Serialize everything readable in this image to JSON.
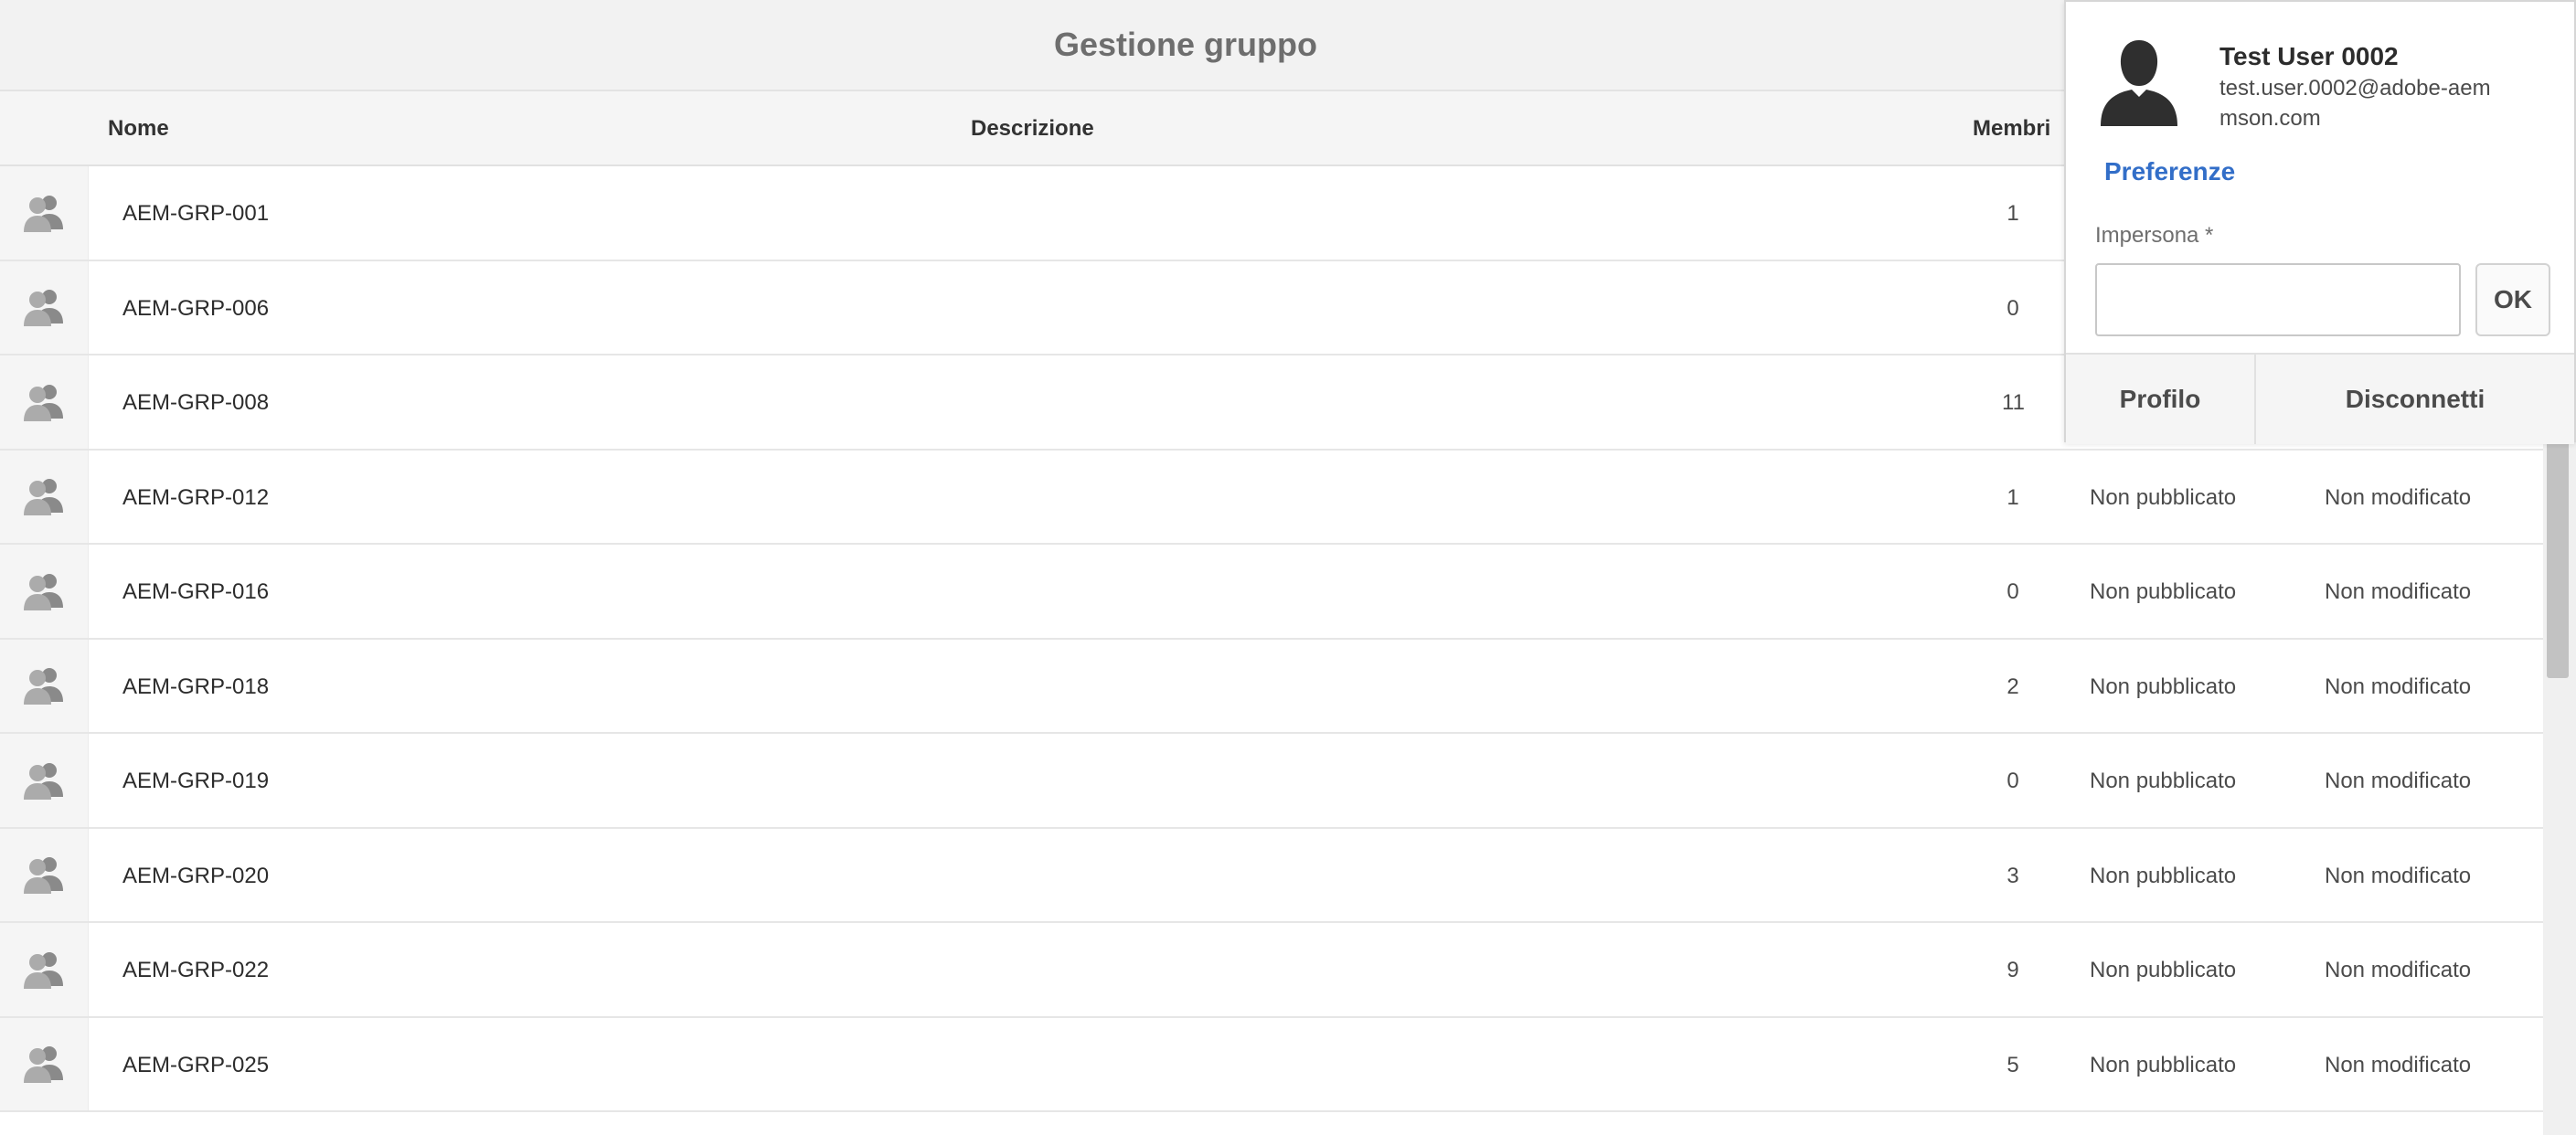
{
  "header": {
    "title": "Gestione gruppo"
  },
  "table": {
    "columns": {
      "name": "Nome",
      "description": "Descrizione",
      "members": "Membri"
    },
    "rows": [
      {
        "name": "AEM-GRP-001",
        "members": "1",
        "publication": "",
        "modification": ""
      },
      {
        "name": "AEM-GRP-006",
        "members": "0",
        "publication": "",
        "modification": ""
      },
      {
        "name": "AEM-GRP-008",
        "members": "11",
        "publication": "",
        "modification": ""
      },
      {
        "name": "AEM-GRP-012",
        "members": "1",
        "publication": "Non pubblicato",
        "modification": "Non modificato"
      },
      {
        "name": "AEM-GRP-016",
        "members": "0",
        "publication": "Non pubblicato",
        "modification": "Non modificato"
      },
      {
        "name": "AEM-GRP-018",
        "members": "2",
        "publication": "Non pubblicato",
        "modification": "Non modificato"
      },
      {
        "name": "AEM-GRP-019",
        "members": "0",
        "publication": "Non pubblicato",
        "modification": "Non modificato"
      },
      {
        "name": "AEM-GRP-020",
        "members": "3",
        "publication": "Non pubblicato",
        "modification": "Non modificato"
      },
      {
        "name": "AEM-GRP-022",
        "members": "9",
        "publication": "Non pubblicato",
        "modification": "Non modificato"
      },
      {
        "name": "AEM-GRP-025",
        "members": "5",
        "publication": "Non pubblicato",
        "modification": "Non modificato"
      }
    ]
  },
  "user_popover": {
    "name": "Test User 0002",
    "email": "test.user.0002@adobe-aemmson.com",
    "preferences_link": "Preferenze",
    "impersonate_label": "Impersona *",
    "impersonate_value": "",
    "ok_button": "OK",
    "profile_button": "Profilo",
    "logout_button": "Disconnetti"
  },
  "icons": {
    "row_icon": "group-icon",
    "avatar_icon": "user-avatar-icon"
  },
  "colors": {
    "link": "#326ec8",
    "title": "#6e6e6e",
    "header_bg": "#f2f2f2"
  }
}
